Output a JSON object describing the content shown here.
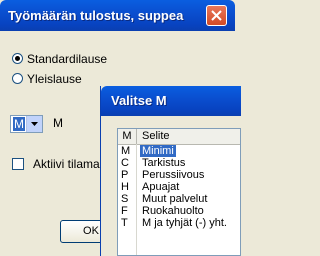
{
  "main_window": {
    "title": "Työmäärän tulostus, suppea",
    "options": [
      {
        "label": "Standardilause",
        "selected": true
      },
      {
        "label": "Yleislause",
        "selected": false
      }
    ],
    "combo": {
      "value": "M",
      "label": "M"
    },
    "checkbox": {
      "label": "Aktiivi tilamalli",
      "checked": false
    },
    "ok_label": "OK"
  },
  "popup": {
    "title": "Valitse M",
    "columns": [
      "M",
      "Selite"
    ],
    "rows": [
      {
        "code": "M",
        "desc": "Minimi",
        "selected": true
      },
      {
        "code": "C",
        "desc": "Tarkistus",
        "selected": false
      },
      {
        "code": "P",
        "desc": "Perussiivous",
        "selected": false
      },
      {
        "code": "H",
        "desc": "Apuajat",
        "selected": false
      },
      {
        "code": "S",
        "desc": "Muut palvelut",
        "selected": false
      },
      {
        "code": "F",
        "desc": "Ruokahuolto",
        "selected": false
      },
      {
        "code": "T",
        "desc": "M ja tyhjät (-) yht.",
        "selected": false
      }
    ]
  }
}
